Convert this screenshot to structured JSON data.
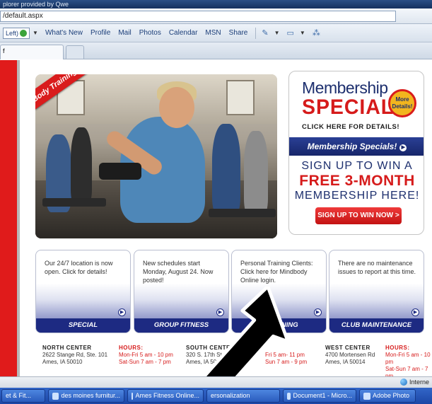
{
  "window": {
    "title": "plorer provided by Qwe",
    "url": "/default.aspx"
  },
  "links_bar": {
    "left_button": "Left)",
    "items": [
      "What's New",
      "Profile",
      "Mail",
      "Photos",
      "Calendar",
      "MSN",
      "Share"
    ]
  },
  "tab": {
    "label": "f"
  },
  "hero": {
    "banner": "Body Training System Classes"
  },
  "membership": {
    "title": "Membership",
    "specials": "SPECIALS",
    "badge_line1": "More",
    "badge_line2": "Details!",
    "click_here": "CLICK HERE FOR DETAILS!",
    "bar_label": "Membership Specials!",
    "sign_up": "SIGN UP TO WIN A",
    "free": "FREE 3-MONTH",
    "membership_here": "MEMBERSHIP HERE!",
    "button": "SIGN UP TO WIN NOW >"
  },
  "info_boxes": [
    {
      "text": "Our 24/7 location is now open. Click for details!",
      "footer": "SPECIAL ANNOUNCEMENTS!"
    },
    {
      "text": "New schedules start Monday, August 24. Now posted!",
      "footer": "GROUP FITNESS"
    },
    {
      "text": "Personal Training Clients: Click here for Mindbody Online login.",
      "footer": "L TRAINING"
    },
    {
      "text": "There are no maintenance issues to report at this time.",
      "footer": "CLUB MAINTENANCE"
    }
  ],
  "locations": {
    "north": {
      "name": "NORTH CENTER",
      "line1": "2622 Stange Rd, Ste. 101",
      "line2": "Ames, IA 50010"
    },
    "north_hours": {
      "name": "HOURS:",
      "line1": "Mon-Fri 5 am - 10 pm",
      "line2": "Sat-Sun 7 am - 7 pm"
    },
    "south": {
      "name": "SOUTH CENTER",
      "line1": "320 S. 17th St",
      "line2": "Ames, IA 500"
    },
    "south_hours": {
      "line1": "Fri 5 am- 11 pm",
      "line2": "Sun 7 am - 9 pm"
    },
    "west": {
      "name": "WEST CENTER",
      "line1": "4700 Mortensen Rd",
      "line2": "Ames, IA 50014"
    },
    "west_hours": {
      "name": "HOURS:",
      "line1": "Mon-Fri 5 am - 10 pm",
      "line2": "Sat-Sun 7 am - 7 pm"
    }
  },
  "status": {
    "zone": "Interne"
  },
  "taskbar": [
    {
      "label": "et & Fit..."
    },
    {
      "label": "des moines furnitur..."
    },
    {
      "label": "Ames Fitness Online..."
    },
    {
      "label": "ersonalization"
    },
    {
      "label": "Document1 - Micro..."
    },
    {
      "label": "Adobe Photo"
    }
  ],
  "colors": {
    "brand_red": "#d61b1b",
    "brand_navy": "#1d2a82",
    "accent_yellow": "#f2b51e"
  }
}
